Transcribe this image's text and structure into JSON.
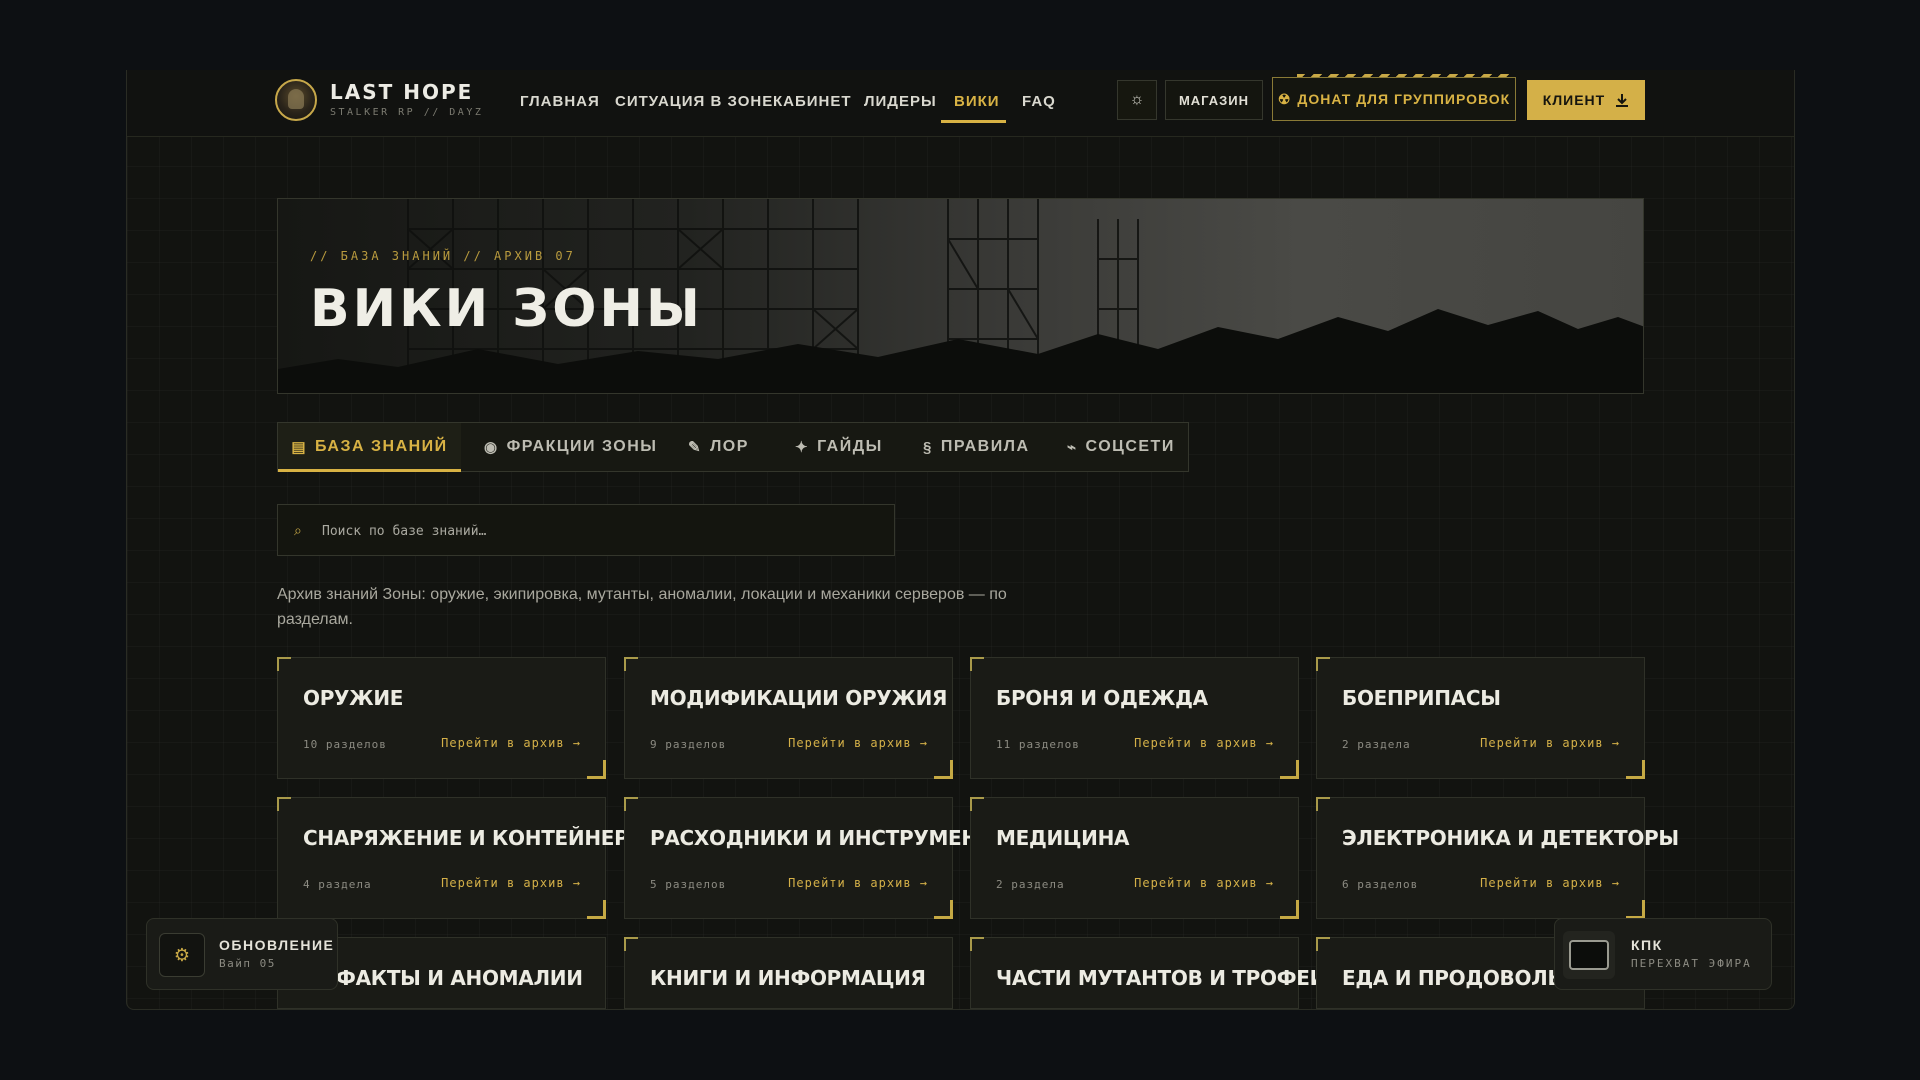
{
  "header": {
    "brand": "LAST HOPE",
    "brand_sub": "STALKER RP // DAYZ",
    "nav": [
      "ГЛАВНАЯ",
      "СИТУАЦИЯ В ЗОНЕ",
      "КАБИНЕТ",
      "ЛИДЕРЫ",
      "ВИКИ",
      "FAQ"
    ],
    "active_nav": "ВИКИ",
    "shop_label": "МАГАЗИН",
    "donate_label": "ДОНАТ ДЛЯ ГРУППИРОВОК",
    "client_label": "КЛИЕНТ"
  },
  "hero": {
    "kicker": "// БАЗА ЗНАНИЙ // АРХИВ 07",
    "title": "ВИКИ ЗОНЫ"
  },
  "tabs": [
    {
      "icon": "▤",
      "label": "БАЗА ЗНАНИЙ"
    },
    {
      "icon": "◉",
      "label": "ФРАКЦИИ ЗОНЫ"
    },
    {
      "icon": "✎",
      "label": "ЛОР"
    },
    {
      "icon": "✦",
      "label": "ГАЙДЫ"
    },
    {
      "icon": "§",
      "label": "ПРАВИЛА"
    },
    {
      "icon": "⌁",
      "label": "СОЦСЕТИ"
    }
  ],
  "search": {
    "placeholder": "Поиск по базе знаний…",
    "value": ""
  },
  "description": "Архив знаний Зоны: оружие, экипировка, мутанты, аномалии, локации и механики серверов — по разделам.",
  "link_label": "Перейти в архив →",
  "cards": [
    {
      "title": "ОРУЖИЕ",
      "count": "10 разделов"
    },
    {
      "title": "МОДИФИКАЦИИ ОРУЖИЯ",
      "count": "9 разделов"
    },
    {
      "title": "БРОНЯ И ОДЕЖДА",
      "count": "11 разделов"
    },
    {
      "title": "БОЕПРИПАСЫ",
      "count": "2 раздела"
    },
    {
      "title": "СНАРЯЖЕНИЕ И КОНТЕЙНЕРЫ",
      "count": "4 раздела"
    },
    {
      "title": "РАСХОДНИКИ И ИНСТРУМЕНТЫ",
      "count": "5 разделов"
    },
    {
      "title": "МЕДИЦИНА",
      "count": "2 раздела"
    },
    {
      "title": "ЭЛЕКТРОНИКА И ДЕТЕКТОРЫ",
      "count": "6 разделов"
    },
    {
      "title": "…ЕФАКТЫ И АНОМАЛИИ",
      "count": ""
    },
    {
      "title": "КНИГИ И ИНФОРМАЦИЯ",
      "count": ""
    },
    {
      "title": "ЧАСТИ МУТАНТОВ И ТРОФЕИ",
      "count": ""
    },
    {
      "title": "ЕДА И ПРОДОВОЛЬСТВИЕ",
      "count": ""
    }
  ],
  "toast_update": {
    "title": "ОБНОВЛЕНИЕ",
    "sub": "Вайп 05"
  },
  "toast_kpk": {
    "title": "КПК",
    "sub": "ПЕРЕХВАТ ЭФИРА"
  },
  "colors": {
    "accent": "#d4b048",
    "background": "#0d1013",
    "panel": "#1a1b16"
  }
}
